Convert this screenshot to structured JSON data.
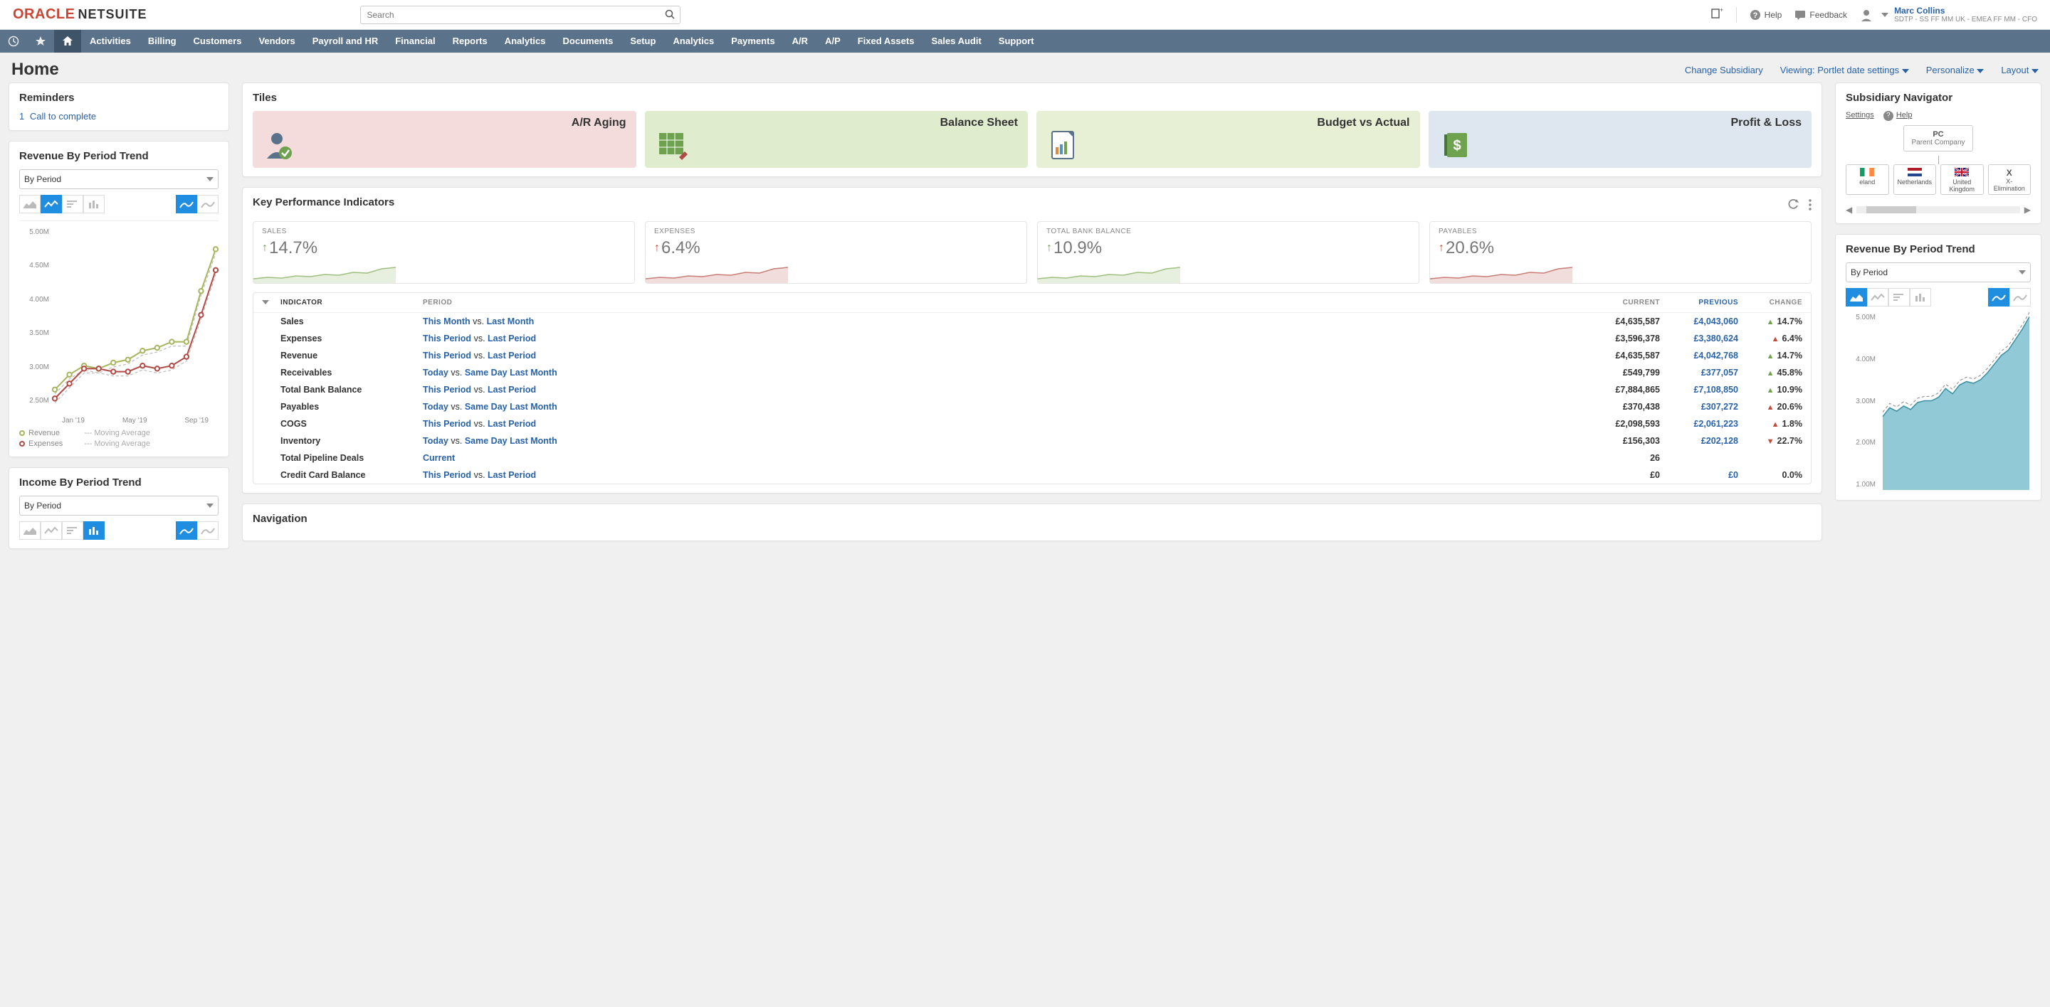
{
  "brand": {
    "oracle": "ORACLE",
    "netsuite": "NETSUITE"
  },
  "search": {
    "placeholder": "Search"
  },
  "topright": {
    "help": "Help",
    "feedback": "Feedback",
    "username": "Marc Collins",
    "userrole": "SDTP - SS FF MM UK - EMEA FF MM - CFO"
  },
  "nav": [
    "Activities",
    "Billing",
    "Customers",
    "Vendors",
    "Payroll and HR",
    "Financial",
    "Reports",
    "Analytics",
    "Documents",
    "Setup",
    "Analytics",
    "Payments",
    "A/R",
    "A/P",
    "Fixed Assets",
    "Sales Audit",
    "Support"
  ],
  "page": {
    "title": "Home",
    "actions": {
      "change_sub": "Change Subsidiary",
      "viewing": "Viewing: Portlet date settings",
      "personalize": "Personalize",
      "layout": "Layout"
    }
  },
  "reminders": {
    "title": "Reminders",
    "items": [
      {
        "count": "1",
        "label": "Call to complete"
      }
    ]
  },
  "revenue_trend_left": {
    "title": "Revenue By Period Trend",
    "select": "By Period",
    "legend": {
      "s1": "Revenue",
      "s2": "Expenses",
      "m1": "Moving Average",
      "m2": "Moving Average"
    }
  },
  "income_trend": {
    "title": "Income By Period Trend",
    "select": "By Period"
  },
  "tiles": {
    "title": "Tiles",
    "items": [
      "A/R Aging",
      "Balance Sheet",
      "Budget vs Actual",
      "Profit & Loss"
    ]
  },
  "kpi": {
    "title": "Key Performance Indicators",
    "cards": [
      {
        "label": "SALES",
        "value": "14.7%",
        "dir": "up",
        "color": "green"
      },
      {
        "label": "EXPENSES",
        "value": "6.4%",
        "dir": "up",
        "color": "red"
      },
      {
        "label": "TOTAL BANK BALANCE",
        "value": "10.9%",
        "dir": "up",
        "color": "green"
      },
      {
        "label": "PAYABLES",
        "value": "20.6%",
        "dir": "up",
        "color": "red"
      }
    ],
    "headers": {
      "indicator": "INDICATOR",
      "period": "PERIOD",
      "current": "CURRENT",
      "previous": "PREVIOUS",
      "change": "CHANGE"
    },
    "rows": [
      {
        "ind": "Sales",
        "p1": "This Month",
        "p2": "Last Month",
        "cur": "£4,635,587",
        "prev": "£4,043,060",
        "chg": "14.7%",
        "dir": "up"
      },
      {
        "ind": "Expenses",
        "p1": "This Period",
        "p2": "Last Period",
        "cur": "£3,596,378",
        "prev": "£3,380,624",
        "chg": "6.4%",
        "dir": "up-red"
      },
      {
        "ind": "Revenue",
        "p1": "This Period",
        "p2": "Last Period",
        "cur": "£4,635,587",
        "prev": "£4,042,768",
        "chg": "14.7%",
        "dir": "up"
      },
      {
        "ind": "Receivables",
        "p1": "Today",
        "p2": "Same Day Last Month",
        "cur": "£549,799",
        "prev": "£377,057",
        "chg": "45.8%",
        "dir": "up"
      },
      {
        "ind": "Total Bank Balance",
        "p1": "This Period",
        "p2": "Last Period",
        "cur": "£7,884,865",
        "prev": "£7,108,850",
        "chg": "10.9%",
        "dir": "up"
      },
      {
        "ind": "Payables",
        "p1": "Today",
        "p2": "Same Day Last Month",
        "cur": "£370,438",
        "prev": "£307,272",
        "chg": "20.6%",
        "dir": "up-red"
      },
      {
        "ind": "COGS",
        "p1": "This Period",
        "p2": "Last Period",
        "cur": "£2,098,593",
        "prev": "£2,061,223",
        "chg": "1.8%",
        "dir": "up-red"
      },
      {
        "ind": "Inventory",
        "p1": "Today",
        "p2": "Same Day Last Month",
        "cur": "£156,303",
        "prev": "£202,128",
        "chg": "22.7%",
        "dir": "down"
      },
      {
        "ind": "Total Pipeline Deals",
        "p1": "Current",
        "p2": "",
        "cur": "26",
        "prev": "",
        "chg": "",
        "dir": ""
      },
      {
        "ind": "Credit Card Balance",
        "p1": "This Period",
        "p2": "Last Period",
        "cur": "£0",
        "prev": "£0",
        "chg": "0.0%",
        "dir": "none"
      }
    ]
  },
  "navigation": {
    "title": "Navigation"
  },
  "subnav": {
    "title": "Subsidiary Navigator",
    "settings": "Settings",
    "help": "Help",
    "parent": {
      "code": "PC",
      "name": "Parent Company"
    },
    "children": [
      {
        "name": "eland"
      },
      {
        "name": "Netherlands"
      },
      {
        "name": "United Kingdom"
      },
      {
        "name": "X",
        "sub": "X-Elimination"
      }
    ]
  },
  "revenue_trend_right": {
    "title": "Revenue By Period Trend",
    "select": "By Period"
  },
  "chart_data": {
    "left_line": {
      "type": "line",
      "x_labels": [
        "Jan '19",
        "May '19",
        "Sep '19"
      ],
      "y_ticks": [
        "5.00M",
        "4.50M",
        "4.00M",
        "3.50M",
        "3.00M",
        "2.50M"
      ],
      "ylim": [
        2.0,
        5.0
      ],
      "series": [
        {
          "name": "Revenue",
          "color": "#a6b55e",
          "values": [
            2.3,
            2.55,
            2.7,
            2.65,
            2.75,
            2.8,
            2.95,
            3.0,
            3.1,
            3.1,
            3.95,
            4.65
          ]
        },
        {
          "name": "Expenses",
          "color": "#b04a44",
          "values": [
            2.15,
            2.4,
            2.65,
            2.65,
            2.6,
            2.6,
            2.7,
            2.65,
            2.7,
            2.85,
            3.55,
            4.3
          ]
        }
      ]
    },
    "right_area": {
      "type": "area",
      "y_ticks": [
        "5.00M",
        "4.00M",
        "3.00M",
        "2.00M",
        "1.00M"
      ],
      "ylim": [
        0.5,
        5.5
      ],
      "values": [
        2.6,
        2.85,
        2.75,
        2.9,
        2.8,
        3.0,
        3.05,
        3.05,
        3.15,
        3.4,
        3.25,
        3.5,
        3.6,
        3.55,
        3.65,
        3.85,
        4.1,
        4.35,
        4.5,
        4.8,
        5.1,
        5.45
      ]
    }
  }
}
